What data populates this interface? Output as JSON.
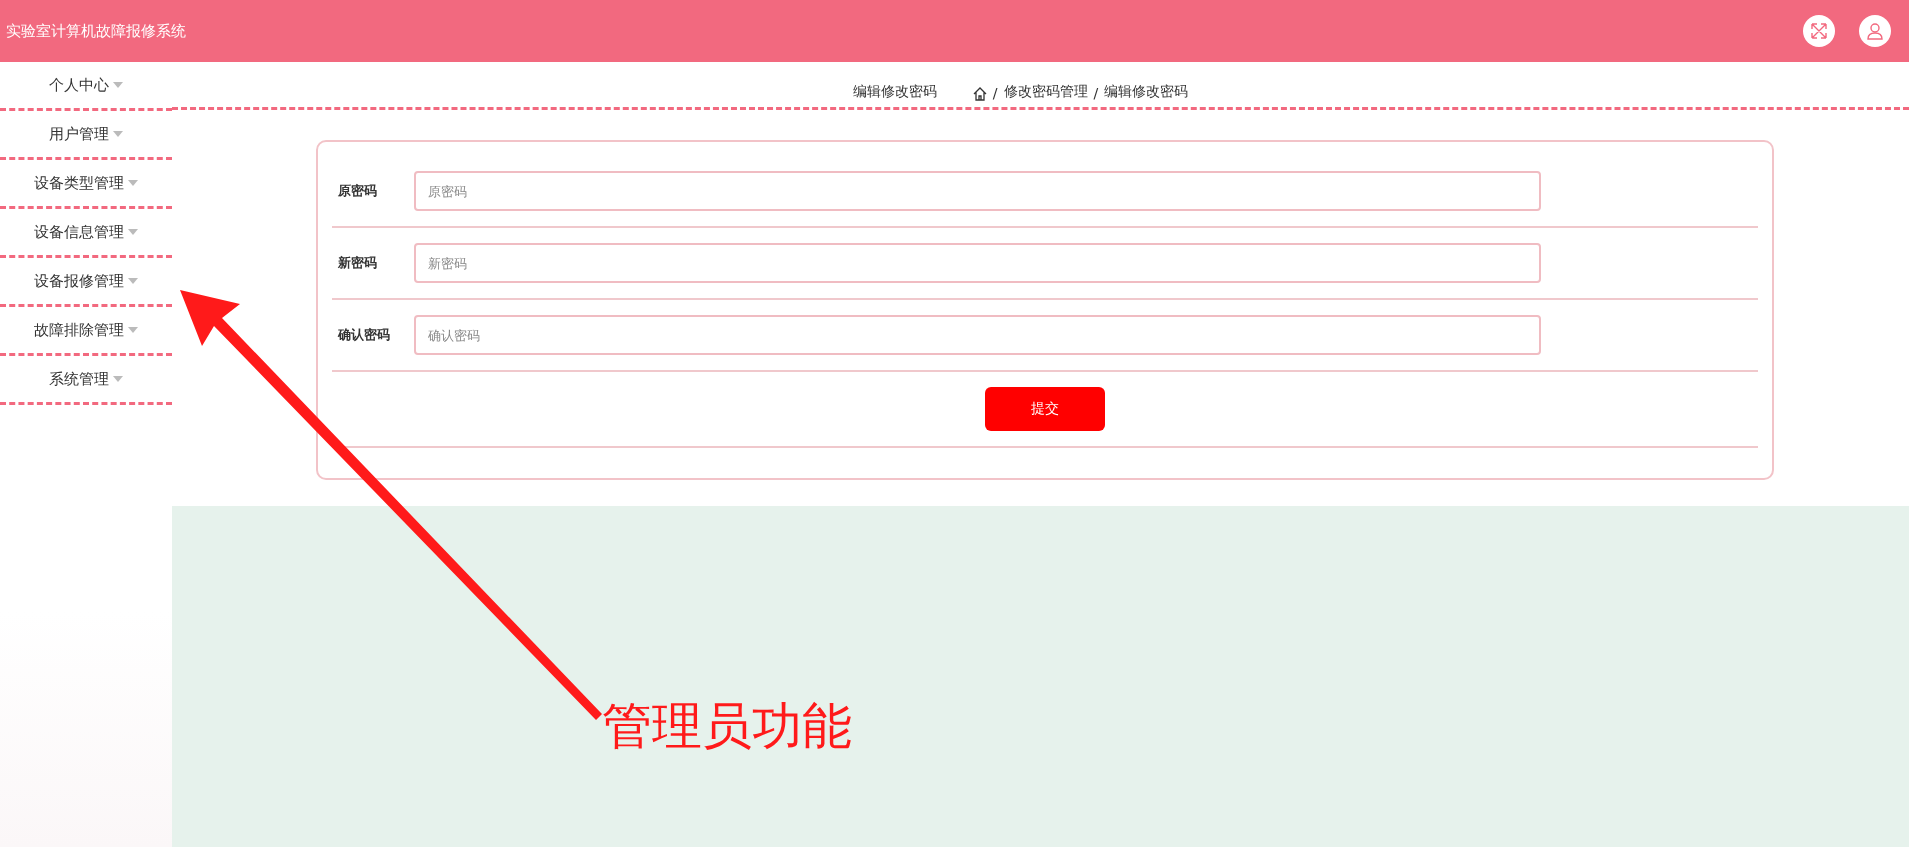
{
  "header": {
    "title": "实验室计算机故障报修系统"
  },
  "sidebar": {
    "items": [
      {
        "label": "个人中心"
      },
      {
        "label": "用户管理"
      },
      {
        "label": "设备类型管理"
      },
      {
        "label": "设备信息管理"
      },
      {
        "label": "设备报修管理"
      },
      {
        "label": "故障排除管理"
      },
      {
        "label": "系统管理"
      }
    ]
  },
  "breadcrumb": {
    "title": "编辑修改密码",
    "separator": "/",
    "items": [
      "修改密码管理",
      "编辑修改密码"
    ]
  },
  "form": {
    "fields": [
      {
        "label": "原密码",
        "placeholder": "原密码"
      },
      {
        "label": "新密码",
        "placeholder": "新密码"
      },
      {
        "label": "确认密码",
        "placeholder": "确认密码"
      }
    ],
    "submit": "提交"
  },
  "annotation": {
    "text": "管理员功能"
  }
}
